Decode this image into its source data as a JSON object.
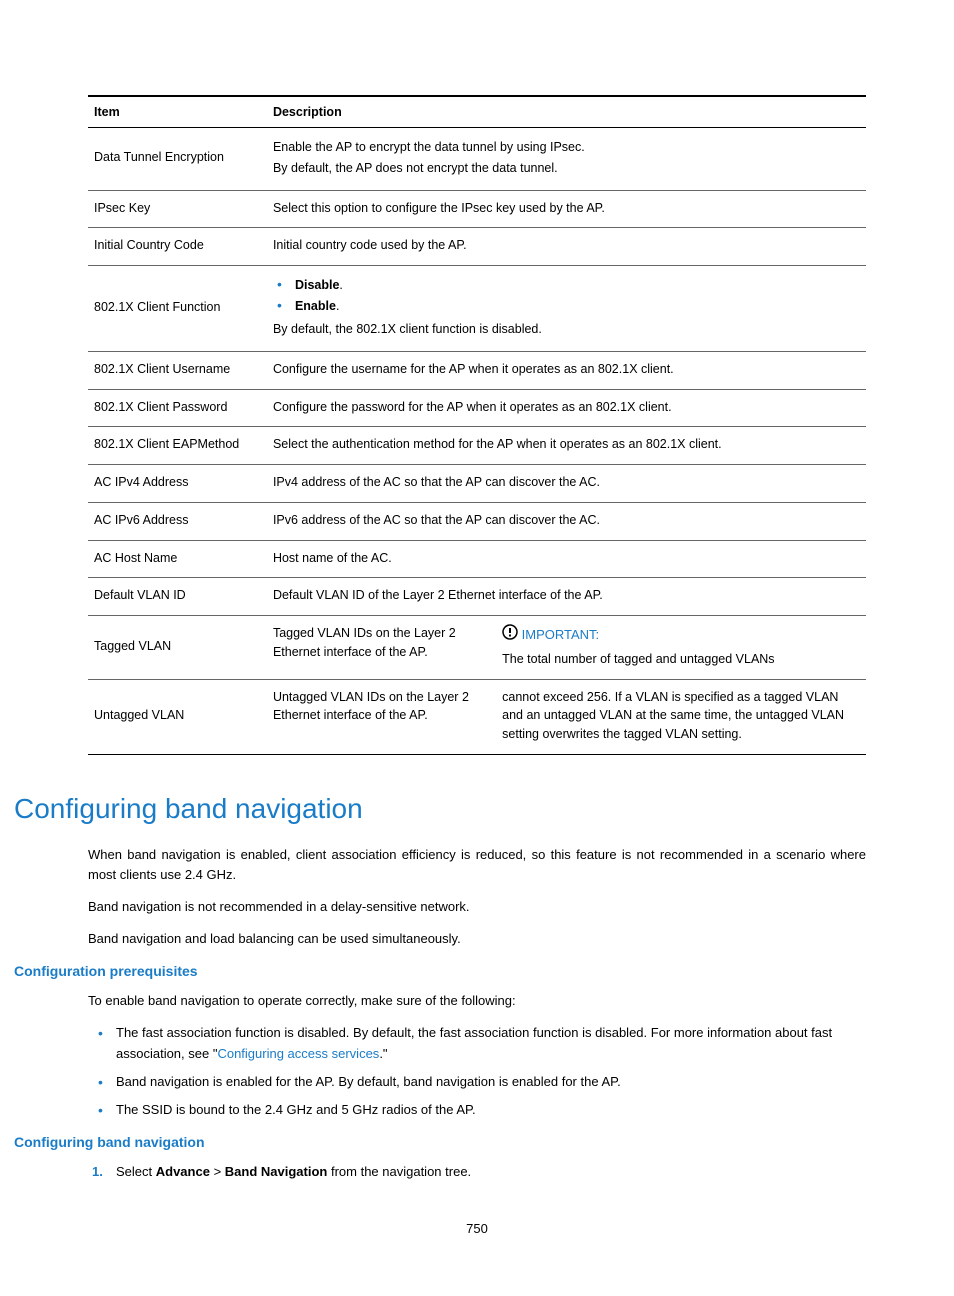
{
  "table": {
    "headers": {
      "item": "Item",
      "description": "Description"
    },
    "rows": {
      "dataTunnel": {
        "item": "Data Tunnel Encryption",
        "line1": "Enable the AP to encrypt the data tunnel by using IPsec.",
        "line2": "By default, the AP does not encrypt the data tunnel."
      },
      "ipsecKey": {
        "item": "IPsec Key",
        "desc": "Select this option to configure the IPsec key used by the AP."
      },
      "countryCode": {
        "item": "Initial Country Code",
        "desc": "Initial country code used by the AP."
      },
      "clientFunc": {
        "item": "802.1X Client Function",
        "opt1": "Disable",
        "opt2": "Enable",
        "note": "By default, the 802.1X client function is disabled."
      },
      "clientUser": {
        "item": "802.1X Client Username",
        "desc": "Configure the username for the AP when it operates as an 802.1X client."
      },
      "clientPass": {
        "item": "802.1X Client Password",
        "desc": "Configure the password for the AP when it operates as an 802.1X client."
      },
      "eapMethod": {
        "item": "802.1X Client EAPMethod",
        "desc": "Select the authentication method for the AP when it operates as an 802.1X client."
      },
      "acIpv4": {
        "item": "AC IPv4 Address",
        "desc": "IPv4 address of the AC so that the AP can discover the AC."
      },
      "acIpv6": {
        "item": "AC IPv6 Address",
        "desc": "IPv6 address of the AC so that the AP can discover the AC."
      },
      "acHost": {
        "item": "AC Host Name",
        "desc": "Host name of the AC."
      },
      "defVlan": {
        "item": "Default VLAN ID",
        "desc": "Default VLAN ID of the Layer 2 Ethernet interface of the AP."
      },
      "taggedVlan": {
        "item": "Tagged VLAN",
        "desc": "Tagged VLAN IDs on the Layer 2 Ethernet interface of the AP."
      },
      "untaggedVlan": {
        "item": "Untagged VLAN",
        "desc": "Untagged VLAN IDs on the Layer 2 Ethernet interface of the AP."
      },
      "importantLabel": "IMPORTANT:",
      "importantText1": "The total number of tagged and untagged VLANs",
      "importantText2": "cannot exceed 256. If a VLAN is specified as a tagged VLAN and an untagged VLAN at the same time, the untagged VLAN setting overwrites the tagged VLAN setting."
    }
  },
  "heading1": "Configuring band navigation",
  "para1": "When band navigation is enabled, client association efficiency is reduced, so this feature is not recommended in a scenario where most clients use 2.4 GHz.",
  "para2": "Band navigation is not recommended in a delay-sensitive network.",
  "para3": "Band navigation and load balancing can be used simultaneously.",
  "subhead1": "Configuration prerequisites",
  "prereqIntro": "To enable band navigation to operate correctly, make sure of the following:",
  "prereq1a": "The fast association function is disabled. By default, the fast association function is disabled. For more information about fast association, see \"",
  "prereq1b": "Configuring access services",
  "prereq1c": ".\"",
  "prereq2": "Band navigation is enabled for the AP. By default, band navigation is enabled for the AP.",
  "prereq3": "The SSID is bound to the 2.4 GHz and 5 GHz radios of the AP.",
  "subhead2": "Configuring band navigation",
  "step1num": "1.",
  "step1a": "Select ",
  "step1b": "Advance",
  "step1c": " > ",
  "step1d": "Band Navigation",
  "step1e": " from the navigation tree.",
  "pageNumber": "750"
}
